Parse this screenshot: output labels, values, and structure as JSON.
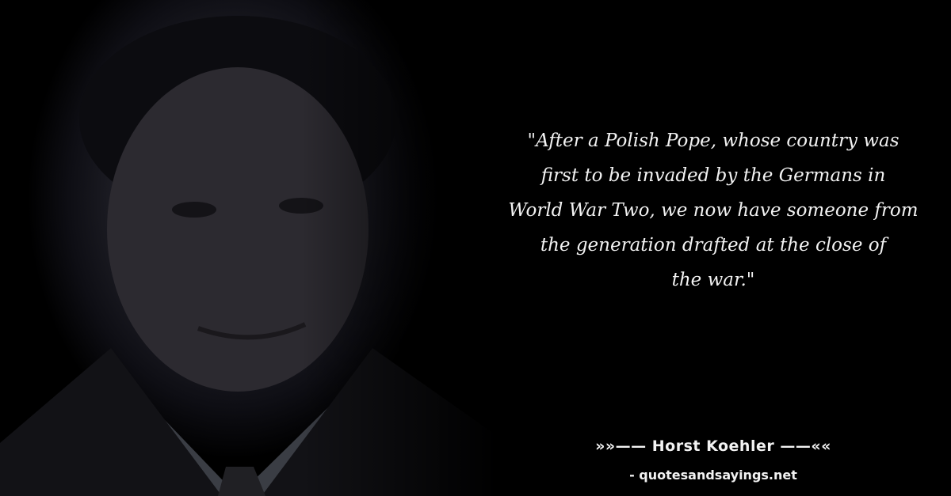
{
  "quote": {
    "text": "\"After a Polish Pope, whose country was\nfirst to be invaded by the Germans in\nWorld War Two, we now have someone from\nthe generation drafted at the close of\nthe war.\""
  },
  "author": {
    "line": "»»—— Horst Koehler ——««"
  },
  "site": {
    "credit": "- quotesandsayings.net"
  },
  "portrait": {
    "description_colors": {
      "background": "#000000",
      "face_tone": "#3a3a44"
    }
  }
}
